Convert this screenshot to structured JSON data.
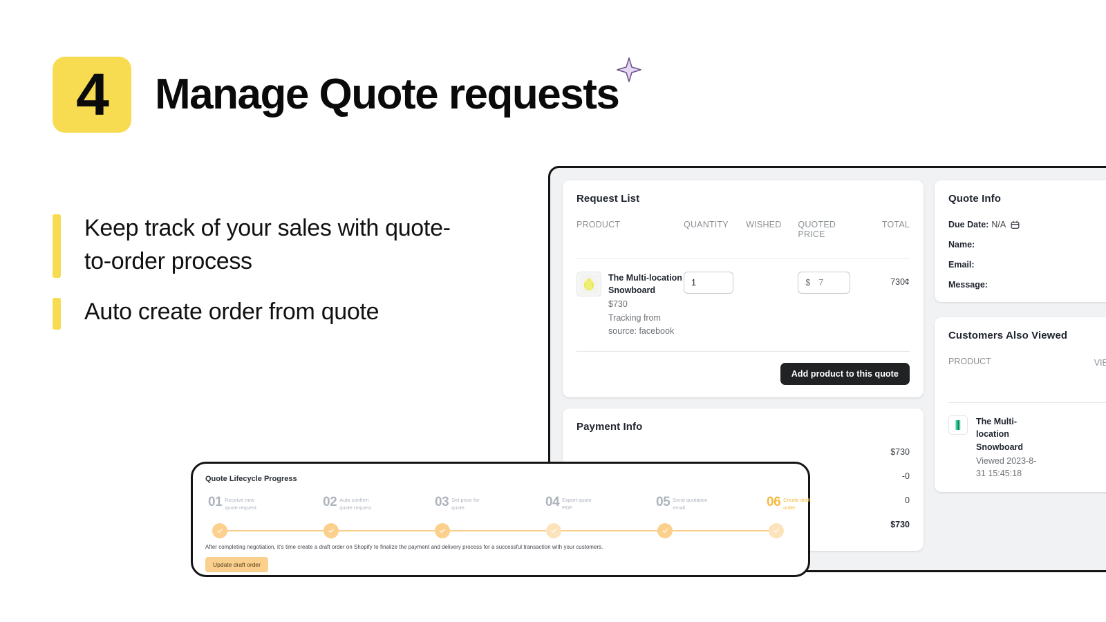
{
  "header": {
    "step_number": "4",
    "title": "Manage Quote requests",
    "sparkle_icon": "sparkle-icon",
    "badge_color": "#f7dc52"
  },
  "bullets": [
    {
      "text": "Keep track of your sales with quote-to-order process"
    },
    {
      "text": "Auto create order from quote"
    }
  ],
  "request_list": {
    "title": "Request List",
    "columns": {
      "product": "PRODUCT",
      "quantity": "QUANTITY",
      "wished": "WISHED",
      "quoted_price": "QUOTED PRICE",
      "total": "TOTAL"
    },
    "rows": [
      {
        "name": "The Multi-location Snowboard",
        "price": "$730",
        "tracking": "Tracking from source: facebook",
        "quantity_value": "1",
        "wished": "",
        "quoted_currency": "$",
        "quoted_value": "7",
        "total": "730¢"
      }
    ],
    "add_product_button": "Add product to this quote"
  },
  "payment_info": {
    "title": "Payment Info",
    "amounts": [
      "$730",
      "-0",
      "0",
      "$730"
    ]
  },
  "quote_info": {
    "title": "Quote Info",
    "due_date_label": "Due Date:",
    "due_date_value": "N/A",
    "calendar_icon": "calendar-icon",
    "name_label": "Name:",
    "name_value": "",
    "email_label": "Email:",
    "email_value": "",
    "message_label": "Message:",
    "message_value": ""
  },
  "customers_also_viewed": {
    "title": "Customers Also Viewed",
    "columns": {
      "product": "PRODUCT",
      "viewed_time": "VIEWED TIME"
    },
    "rows": [
      {
        "name": "The Multi-location Snowboard",
        "viewed": "Viewed 2023-8-31 15:45:18"
      }
    ]
  },
  "lifecycle": {
    "title": "Quote Lifecycle Progress",
    "steps": [
      {
        "num": "01",
        "label": "Receive new quote request",
        "active": false
      },
      {
        "num": "02",
        "label": "Auto confirm quote request",
        "active": false
      },
      {
        "num": "03",
        "label": "Set price for quote",
        "active": false
      },
      {
        "num": "04",
        "label": "Export quote PDF",
        "active": false
      },
      {
        "num": "05",
        "label": "Send quotation email",
        "active": false
      },
      {
        "num": "06",
        "label": "Create draft order",
        "active": true
      }
    ],
    "description": "After completing negotiation, it's time create a draft order on Shopify to finalize the payment and delivery process for a successful transaction with your customers.",
    "button_label": "Update draft order",
    "accent_color": "#fbd08c"
  }
}
